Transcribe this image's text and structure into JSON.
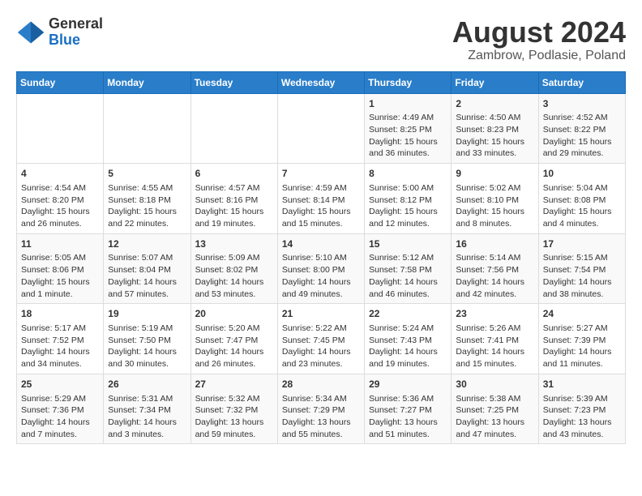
{
  "logo": {
    "line1": "General",
    "line2": "Blue"
  },
  "title": {
    "month_year": "August 2024",
    "location": "Zambrow, Podlasie, Poland"
  },
  "days_of_week": [
    "Sunday",
    "Monday",
    "Tuesday",
    "Wednesday",
    "Thursday",
    "Friday",
    "Saturday"
  ],
  "weeks": [
    {
      "days": [
        {
          "num": "",
          "info": ""
        },
        {
          "num": "",
          "info": ""
        },
        {
          "num": "",
          "info": ""
        },
        {
          "num": "",
          "info": ""
        },
        {
          "num": "1",
          "info": "Sunrise: 4:49 AM\nSunset: 8:25 PM\nDaylight: 15 hours\nand 36 minutes."
        },
        {
          "num": "2",
          "info": "Sunrise: 4:50 AM\nSunset: 8:23 PM\nDaylight: 15 hours\nand 33 minutes."
        },
        {
          "num": "3",
          "info": "Sunrise: 4:52 AM\nSunset: 8:22 PM\nDaylight: 15 hours\nand 29 minutes."
        }
      ]
    },
    {
      "days": [
        {
          "num": "4",
          "info": "Sunrise: 4:54 AM\nSunset: 8:20 PM\nDaylight: 15 hours\nand 26 minutes."
        },
        {
          "num": "5",
          "info": "Sunrise: 4:55 AM\nSunset: 8:18 PM\nDaylight: 15 hours\nand 22 minutes."
        },
        {
          "num": "6",
          "info": "Sunrise: 4:57 AM\nSunset: 8:16 PM\nDaylight: 15 hours\nand 19 minutes."
        },
        {
          "num": "7",
          "info": "Sunrise: 4:59 AM\nSunset: 8:14 PM\nDaylight: 15 hours\nand 15 minutes."
        },
        {
          "num": "8",
          "info": "Sunrise: 5:00 AM\nSunset: 8:12 PM\nDaylight: 15 hours\nand 12 minutes."
        },
        {
          "num": "9",
          "info": "Sunrise: 5:02 AM\nSunset: 8:10 PM\nDaylight: 15 hours\nand 8 minutes."
        },
        {
          "num": "10",
          "info": "Sunrise: 5:04 AM\nSunset: 8:08 PM\nDaylight: 15 hours\nand 4 minutes."
        }
      ]
    },
    {
      "days": [
        {
          "num": "11",
          "info": "Sunrise: 5:05 AM\nSunset: 8:06 PM\nDaylight: 15 hours\nand 1 minute."
        },
        {
          "num": "12",
          "info": "Sunrise: 5:07 AM\nSunset: 8:04 PM\nDaylight: 14 hours\nand 57 minutes."
        },
        {
          "num": "13",
          "info": "Sunrise: 5:09 AM\nSunset: 8:02 PM\nDaylight: 14 hours\nand 53 minutes."
        },
        {
          "num": "14",
          "info": "Sunrise: 5:10 AM\nSunset: 8:00 PM\nDaylight: 14 hours\nand 49 minutes."
        },
        {
          "num": "15",
          "info": "Sunrise: 5:12 AM\nSunset: 7:58 PM\nDaylight: 14 hours\nand 46 minutes."
        },
        {
          "num": "16",
          "info": "Sunrise: 5:14 AM\nSunset: 7:56 PM\nDaylight: 14 hours\nand 42 minutes."
        },
        {
          "num": "17",
          "info": "Sunrise: 5:15 AM\nSunset: 7:54 PM\nDaylight: 14 hours\nand 38 minutes."
        }
      ]
    },
    {
      "days": [
        {
          "num": "18",
          "info": "Sunrise: 5:17 AM\nSunset: 7:52 PM\nDaylight: 14 hours\nand 34 minutes."
        },
        {
          "num": "19",
          "info": "Sunrise: 5:19 AM\nSunset: 7:50 PM\nDaylight: 14 hours\nand 30 minutes."
        },
        {
          "num": "20",
          "info": "Sunrise: 5:20 AM\nSunset: 7:47 PM\nDaylight: 14 hours\nand 26 minutes."
        },
        {
          "num": "21",
          "info": "Sunrise: 5:22 AM\nSunset: 7:45 PM\nDaylight: 14 hours\nand 23 minutes."
        },
        {
          "num": "22",
          "info": "Sunrise: 5:24 AM\nSunset: 7:43 PM\nDaylight: 14 hours\nand 19 minutes."
        },
        {
          "num": "23",
          "info": "Sunrise: 5:26 AM\nSunset: 7:41 PM\nDaylight: 14 hours\nand 15 minutes."
        },
        {
          "num": "24",
          "info": "Sunrise: 5:27 AM\nSunset: 7:39 PM\nDaylight: 14 hours\nand 11 minutes."
        }
      ]
    },
    {
      "days": [
        {
          "num": "25",
          "info": "Sunrise: 5:29 AM\nSunset: 7:36 PM\nDaylight: 14 hours\nand 7 minutes."
        },
        {
          "num": "26",
          "info": "Sunrise: 5:31 AM\nSunset: 7:34 PM\nDaylight: 14 hours\nand 3 minutes."
        },
        {
          "num": "27",
          "info": "Sunrise: 5:32 AM\nSunset: 7:32 PM\nDaylight: 13 hours\nand 59 minutes."
        },
        {
          "num": "28",
          "info": "Sunrise: 5:34 AM\nSunset: 7:29 PM\nDaylight: 13 hours\nand 55 minutes."
        },
        {
          "num": "29",
          "info": "Sunrise: 5:36 AM\nSunset: 7:27 PM\nDaylight: 13 hours\nand 51 minutes."
        },
        {
          "num": "30",
          "info": "Sunrise: 5:38 AM\nSunset: 7:25 PM\nDaylight: 13 hours\nand 47 minutes."
        },
        {
          "num": "31",
          "info": "Sunrise: 5:39 AM\nSunset: 7:23 PM\nDaylight: 13 hours\nand 43 minutes."
        }
      ]
    }
  ]
}
